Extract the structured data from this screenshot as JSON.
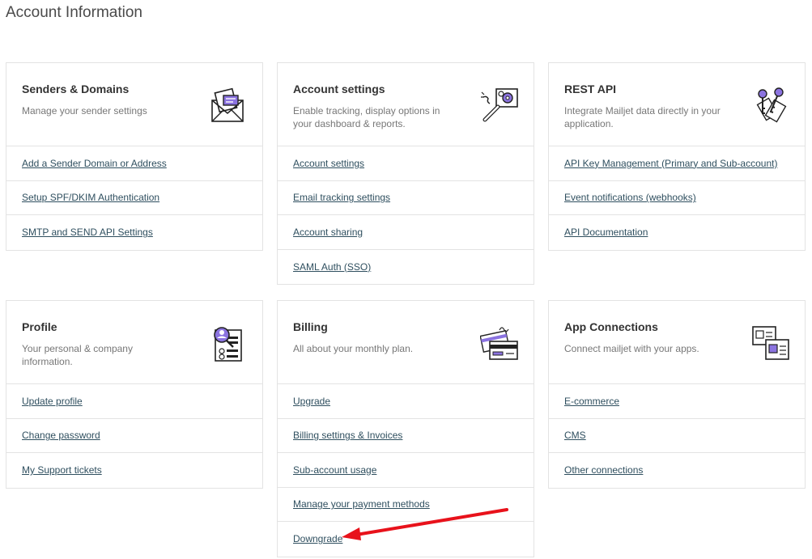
{
  "page_title": "Account Information",
  "colors": {
    "accent": "#7c5fd8",
    "border": "#e3e3e3",
    "link": "#2f4f5f",
    "arrow": "#e8121b"
  },
  "cards": {
    "senders": {
      "title": "Senders & Domains",
      "description": "Manage your sender settings",
      "icon": "envelope-icon",
      "links": [
        "Add a Sender Domain or Address",
        "Setup SPF/DKIM Authentication",
        "SMTP and SEND API Settings"
      ]
    },
    "account": {
      "title": "Account settings",
      "description": "Enable tracking, display options in your dashboard & reports.",
      "icon": "wrench-gear-icon",
      "links": [
        "Account settings",
        "Email tracking settings",
        "Account sharing",
        "SAML Auth (SSO)"
      ]
    },
    "rest": {
      "title": "REST API",
      "description": "Integrate Mailjet data directly in your application.",
      "icon": "keys-icon",
      "links": [
        "API Key Management (Primary and Sub-account)",
        "Event notifications (webhooks)",
        "API Documentation"
      ]
    },
    "profile": {
      "title": "Profile",
      "description": "Your personal & company information.",
      "icon": "profile-search-icon",
      "links": [
        "Update profile",
        "Change password",
        "My Support tickets"
      ]
    },
    "billing": {
      "title": "Billing",
      "description": "All about your monthly plan.",
      "icon": "credit-card-icon",
      "links": [
        "Upgrade",
        "Billing settings & Invoices",
        "Sub-account usage",
        "Manage your payment methods",
        "Downgrade"
      ]
    },
    "apps": {
      "title": "App Connections",
      "description": "Connect mailjet with your apps.",
      "icon": "puzzle-connect-icon",
      "links": [
        "E-commerce",
        "CMS",
        "Other connections"
      ]
    }
  }
}
